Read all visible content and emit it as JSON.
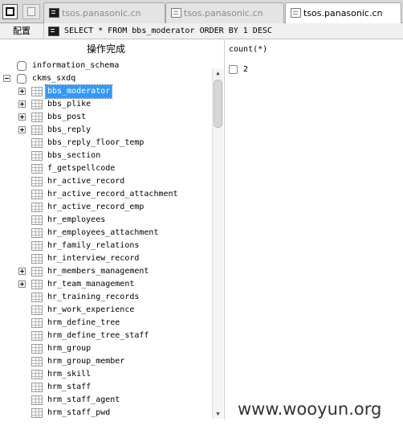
{
  "tabs": [
    {
      "label": "tsos.panasonic.cn",
      "active": false
    },
    {
      "label": "tsos.panasonic.cn",
      "active": false
    },
    {
      "label": "tsos.panasonic.cn",
      "active": true
    }
  ],
  "toolbar": {
    "config_label": "配置",
    "query": "SELECT * FROM bbs_moderator ORDER BY 1 DESC"
  },
  "tree": {
    "title": "操作完成",
    "databases": [
      {
        "name": "information_schema",
        "expanded": false
      },
      {
        "name": "ckms_sxdq",
        "expanded": true
      }
    ],
    "tables": [
      {
        "name": "bbs_moderator",
        "expandable": true,
        "selected": true
      },
      {
        "name": "bbs_plike",
        "expandable": true,
        "selected": false
      },
      {
        "name": "bbs_post",
        "expandable": true,
        "selected": false
      },
      {
        "name": "bbs_reply",
        "expandable": true,
        "selected": false
      },
      {
        "name": "bbs_reply_floor_temp",
        "expandable": false,
        "selected": false
      },
      {
        "name": "bbs_section",
        "expandable": false,
        "selected": false
      },
      {
        "name": "f_getspellcode",
        "expandable": false,
        "selected": false
      },
      {
        "name": "hr_active_record",
        "expandable": false,
        "selected": false
      },
      {
        "name": "hr_active_record_attachment",
        "expandable": false,
        "selected": false
      },
      {
        "name": "hr_active_record_emp",
        "expandable": false,
        "selected": false
      },
      {
        "name": "hr_employees",
        "expandable": false,
        "selected": false
      },
      {
        "name": "hr_employees_attachment",
        "expandable": false,
        "selected": false
      },
      {
        "name": "hr_family_relations",
        "expandable": false,
        "selected": false
      },
      {
        "name": "hr_interview_record",
        "expandable": false,
        "selected": false
      },
      {
        "name": "hr_members_management",
        "expandable": true,
        "selected": false
      },
      {
        "name": "hr_team_management",
        "expandable": true,
        "selected": false
      },
      {
        "name": "hr_training_records",
        "expandable": false,
        "selected": false
      },
      {
        "name": "hr_work_experience",
        "expandable": false,
        "selected": false
      },
      {
        "name": "hrm_define_tree",
        "expandable": false,
        "selected": false
      },
      {
        "name": "hrm_define_tree_staff",
        "expandable": false,
        "selected": false
      },
      {
        "name": "hrm_group",
        "expandable": false,
        "selected": false
      },
      {
        "name": "hrm_group_member",
        "expandable": false,
        "selected": false
      },
      {
        "name": "hrm_skill",
        "expandable": false,
        "selected": false
      },
      {
        "name": "hrm_staff",
        "expandable": false,
        "selected": false
      },
      {
        "name": "hrm_staff_agent",
        "expandable": false,
        "selected": false
      },
      {
        "name": "hrm_staff_pwd",
        "expandable": false,
        "selected": false
      }
    ]
  },
  "results": {
    "column": "count(*)",
    "rows": [
      "2"
    ]
  },
  "watermark": "www.wooyun.org",
  "colors": {
    "selection": "#3399ff",
    "tab_strip": "#d9d9d9"
  },
  "icons": {
    "tab": [
      "terminal-icon",
      "document-icon",
      "document-icon"
    ],
    "query": "terminal-icon",
    "database": "database-icon",
    "table": "table-grid-icon",
    "expand": "plus-box-icon",
    "collapse": "minus-box-icon"
  }
}
